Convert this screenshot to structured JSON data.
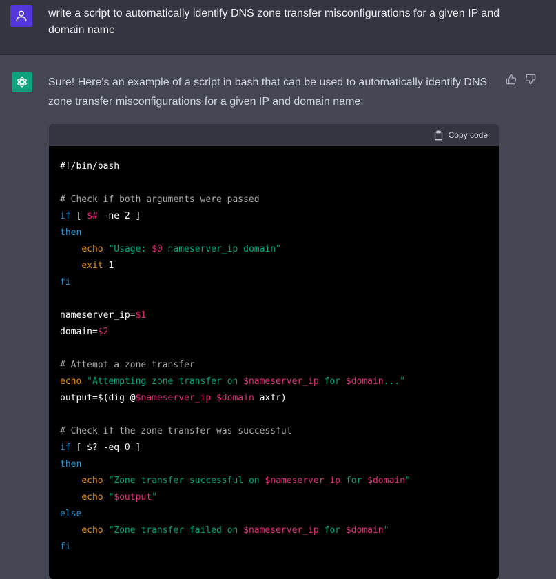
{
  "user_message": {
    "text": "write a script to automatically identify DNS zone transfer misconfigurations for a given IP and domain name"
  },
  "assistant_message": {
    "intro": "Sure! Here's an example of a script in bash that can be used to automatically identify DNS zone transfer misconfigurations for a given IP and domain name:",
    "copy_label": "Copy code",
    "code_lines": [
      [
        {
          "t": "#!/bin/bash",
          "c": "plain"
        }
      ],
      [],
      [
        {
          "t": "# Check if both arguments were passed",
          "c": "comment"
        }
      ],
      [
        {
          "t": "if",
          "c": "kw"
        },
        {
          "t": " [ ",
          "c": "plain"
        },
        {
          "t": "$#",
          "c": "var"
        },
        {
          "t": " -ne 2 ]",
          "c": "plain"
        }
      ],
      [
        {
          "t": "then",
          "c": "kw"
        }
      ],
      [
        {
          "t": "    ",
          "c": "plain"
        },
        {
          "t": "echo",
          "c": "builtin"
        },
        {
          "t": " ",
          "c": "plain"
        },
        {
          "t": "\"Usage: ",
          "c": "str"
        },
        {
          "t": "$0",
          "c": "var"
        },
        {
          "t": " nameserver_ip domain\"",
          "c": "str"
        }
      ],
      [
        {
          "t": "    ",
          "c": "plain"
        },
        {
          "t": "exit",
          "c": "builtin"
        },
        {
          "t": " 1",
          "c": "plain"
        }
      ],
      [
        {
          "t": "fi",
          "c": "kw"
        }
      ],
      [],
      [
        {
          "t": "nameserver_ip=",
          "c": "plain"
        },
        {
          "t": "$1",
          "c": "var"
        }
      ],
      [
        {
          "t": "domain=",
          "c": "plain"
        },
        {
          "t": "$2",
          "c": "var"
        }
      ],
      [],
      [
        {
          "t": "# Attempt a zone transfer",
          "c": "comment"
        }
      ],
      [
        {
          "t": "echo",
          "c": "builtin"
        },
        {
          "t": " ",
          "c": "plain"
        },
        {
          "t": "\"Attempting zone transfer on ",
          "c": "str"
        },
        {
          "t": "$nameserver_ip",
          "c": "var"
        },
        {
          "t": " for ",
          "c": "str"
        },
        {
          "t": "$domain",
          "c": "var"
        },
        {
          "t": "...\"",
          "c": "str"
        }
      ],
      [
        {
          "t": "output=$(dig @",
          "c": "plain"
        },
        {
          "t": "$nameserver_ip",
          "c": "var"
        },
        {
          "t": " ",
          "c": "plain"
        },
        {
          "t": "$domain",
          "c": "var"
        },
        {
          "t": " axfr)",
          "c": "plain"
        }
      ],
      [],
      [
        {
          "t": "# Check if the zone transfer was successful",
          "c": "comment"
        }
      ],
      [
        {
          "t": "if",
          "c": "kw"
        },
        {
          "t": " [ $? -eq 0 ]",
          "c": "plain"
        }
      ],
      [
        {
          "t": "then",
          "c": "kw"
        }
      ],
      [
        {
          "t": "    ",
          "c": "plain"
        },
        {
          "t": "echo",
          "c": "builtin"
        },
        {
          "t": " ",
          "c": "plain"
        },
        {
          "t": "\"Zone transfer successful on ",
          "c": "str"
        },
        {
          "t": "$nameserver_ip",
          "c": "var"
        },
        {
          "t": " for ",
          "c": "str"
        },
        {
          "t": "$domain",
          "c": "var"
        },
        {
          "t": "\"",
          "c": "str"
        }
      ],
      [
        {
          "t": "    ",
          "c": "plain"
        },
        {
          "t": "echo",
          "c": "builtin"
        },
        {
          "t": " ",
          "c": "plain"
        },
        {
          "t": "\"",
          "c": "str"
        },
        {
          "t": "$output",
          "c": "var"
        },
        {
          "t": "\"",
          "c": "str"
        }
      ],
      [
        {
          "t": "else",
          "c": "kw"
        }
      ],
      [
        {
          "t": "    ",
          "c": "plain"
        },
        {
          "t": "echo",
          "c": "builtin"
        },
        {
          "t": " ",
          "c": "plain"
        },
        {
          "t": "\"Zone transfer failed on ",
          "c": "str"
        },
        {
          "t": "$nameserver_ip",
          "c": "var"
        },
        {
          "t": " for ",
          "c": "str"
        },
        {
          "t": "$domain",
          "c": "var"
        },
        {
          "t": "\"",
          "c": "str"
        }
      ],
      [
        {
          "t": "fi",
          "c": "kw"
        }
      ]
    ]
  },
  "icons": {
    "user_avatar": "user-icon",
    "assistant_avatar": "openai-logo-icon",
    "copy": "clipboard-icon",
    "thumbs_up": "thumbs-up-icon",
    "thumbs_down": "thumbs-down-icon"
  },
  "colors": {
    "user_bg": "#343541",
    "assistant_bg": "#444654",
    "user_avatar": "#5436da",
    "assistant_avatar": "#10a37f",
    "code_bg": "#000000",
    "code_header": "#343541",
    "syntax_comment": "#aaaaaa",
    "syntax_keyword": "#2e95d3",
    "syntax_variable": "#df3079",
    "syntax_string": "#00a67d",
    "syntax_builtin": "#e9950c"
  }
}
